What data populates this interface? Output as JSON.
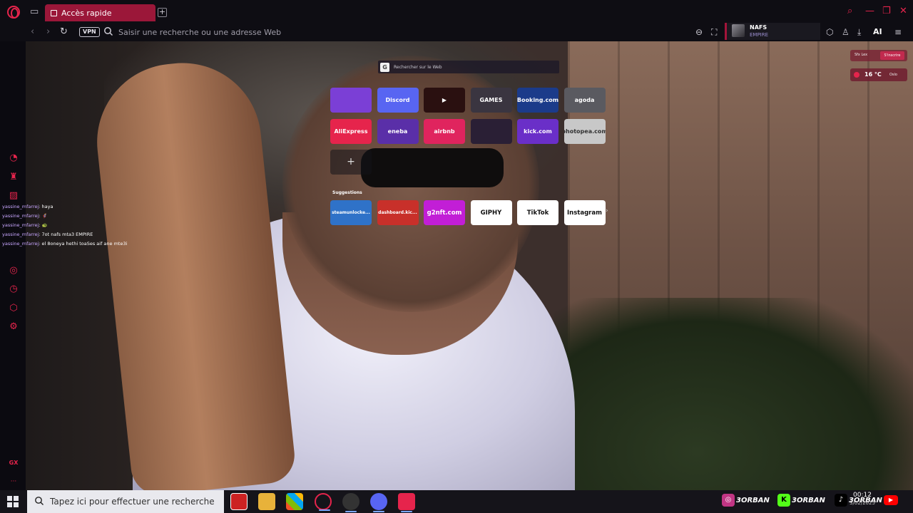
{
  "colors": {
    "accent": "#e6244c",
    "tab_active": "#9b1739",
    "chrome_bg": "#0e0d13"
  },
  "tab": {
    "label": "Accès rapide"
  },
  "address_bar": {
    "vpn_label": "VPN",
    "placeholder": "Saisir une recherche ou une adresse Web"
  },
  "profile": {
    "name": "NAFS",
    "subtitle": "EMPIRE"
  },
  "toolbar": {
    "ai_label": "AI"
  },
  "sidebar": {
    "footer_label": "GX",
    "more_label": "···"
  },
  "speed_dial": {
    "search_engine_letter": "G",
    "search_placeholder": "Rechercher sur le Web",
    "tiles": [
      {
        "label": "",
        "icon": "twitch-icon",
        "bg": "#7b3fd6",
        "name": "twitch"
      },
      {
        "label": "Discord",
        "icon": "discord-icon",
        "bg": "#5865f2",
        "name": "discord"
      },
      {
        "label": "▶",
        "icon": "youtube-icon",
        "bg": "#2a1010",
        "name": "youtube"
      },
      {
        "label": "GAMES",
        "icon": "gx-games-icon",
        "bg": "#3a3540",
        "name": "gx-games"
      },
      {
        "label": "Booking.com",
        "icon": "booking-icon",
        "bg": "#1b3b8a",
        "name": "booking"
      },
      {
        "label": "agoda",
        "icon": "agoda-icon",
        "bg": "#5a5a60",
        "name": "agoda"
      },
      {
        "label": "AliExpress",
        "icon": "aliexpress-icon",
        "bg": "#e6244c",
        "name": "aliexpress"
      },
      {
        "label": "eneba",
        "icon": "eneba-icon",
        "bg": "#5a2fa8",
        "name": "eneba"
      },
      {
        "label": "airbnb",
        "icon": "airbnb-icon",
        "bg": "#e0245e",
        "name": "airbnb"
      },
      {
        "label": "",
        "icon": "gaming-deals-icon",
        "bg": "#2a1f35",
        "name": "gaming-deals"
      },
      {
        "label": "kick.com",
        "icon": "kick-icon",
        "bg": "#6a2fc8",
        "name": "kick"
      },
      {
        "label": "photopea.com",
        "icon": "photopea-icon",
        "bg": "#c8c8c8",
        "name": "photopea"
      }
    ],
    "add_label": "+",
    "suggestions_label": "Suggestions",
    "suggestions": [
      {
        "label": "steamunlocke...",
        "bg": "#2f72c8",
        "name": "steamunlocked"
      },
      {
        "label": "dashboard.kic...",
        "bg": "#c8302a",
        "name": "dashboard-kick"
      },
      {
        "label": "g2nft.com",
        "bg": "#c21ed6",
        "name": "g2nft"
      },
      {
        "label": "GIPHY",
        "bg": "#ffffff",
        "name": "giphy"
      },
      {
        "label": "TikTok",
        "bg": "#ffffff",
        "name": "tiktok"
      },
      {
        "label": "Instagram",
        "bg": "#ffffff",
        "name": "instagram"
      }
    ]
  },
  "weather": {
    "label_a": "Sfx Lex",
    "label_b": "S'inscrire",
    "temp": "16 °C",
    "city": "Oslo"
  },
  "chat": [
    {
      "user": "yassine_mfarrej",
      "msg": ": haya"
    },
    {
      "user": "yassine_mfarrej",
      "msg": ": 🦸"
    },
    {
      "user": "yassine_mfarrej",
      "msg": ": 🐢"
    },
    {
      "user": "yassine_mfarrej",
      "msg": ": 7ot nafs mta3 EMPIRE"
    },
    {
      "user": "yassine_mfarrej",
      "msg": ": el 8oneya hethi toaSes aif ane mte3i"
    }
  ],
  "taskbar": {
    "search_placeholder": "Tapez ici pour effectuer une recherche",
    "badges": [
      "3ORBAN",
      "3ORBAN",
      "3ORBAN"
    ],
    "time": "00:12",
    "date": "3/02/2025"
  }
}
